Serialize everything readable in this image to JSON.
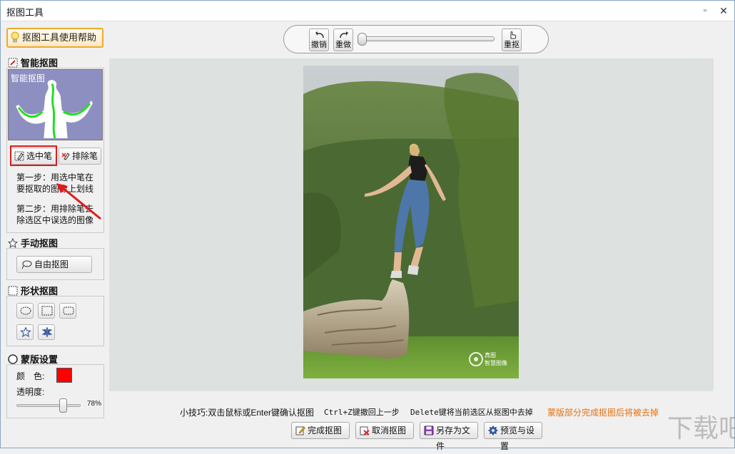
{
  "window": {
    "title": "抠图工具",
    "max_glyph": "▫",
    "close_glyph": "✕"
  },
  "left_panel": {
    "help_button": "抠图工具使用帮助",
    "smart": {
      "heading": "智能抠图",
      "preview_caption": "智能抠图",
      "select_pen": "选中笔",
      "exclude_pen": "排除笔",
      "step1": "第一步：用选中笔在要抠取的图像上划线",
      "step2": "第二步：用排除笔去除选区中误选的图像"
    },
    "manual": {
      "heading": "手动抠图",
      "free_button": "自由抠图"
    },
    "shape": {
      "heading": "形状抠图",
      "shapes": [
        "ellipse-icon",
        "rectangle-icon",
        "rounded-rectangle-icon",
        "star-icon",
        "hexagram-icon"
      ]
    },
    "mask": {
      "heading": "蒙版设置",
      "color_label": "颜　色:",
      "color_value": "#ff0000",
      "opacity_label": "透明度:",
      "opacity_value": "78%",
      "opacity_fraction": 0.78
    }
  },
  "toolbar": {
    "undo": "撤销",
    "redo": "重做",
    "redraw": "重抠",
    "zoom_fraction": 0.0
  },
  "image": {
    "watermark_line1": "真图",
    "watermark_line2": "智慧图像"
  },
  "tips": {
    "tip1": "小技巧:双击鼠标或Enter键确认抠图",
    "tip2": "Ctrl+Z键撤回上一步",
    "tip3": "Delete键将当前选区从抠图中去掉",
    "tip4": "蒙版部分完成抠图后将被去掉"
  },
  "actions": {
    "finish": "完成抠图",
    "cancel": "取消抠图",
    "save_as": "另存为文件",
    "preview_settings": "预览与设置"
  },
  "site_watermark": "下载吧"
}
